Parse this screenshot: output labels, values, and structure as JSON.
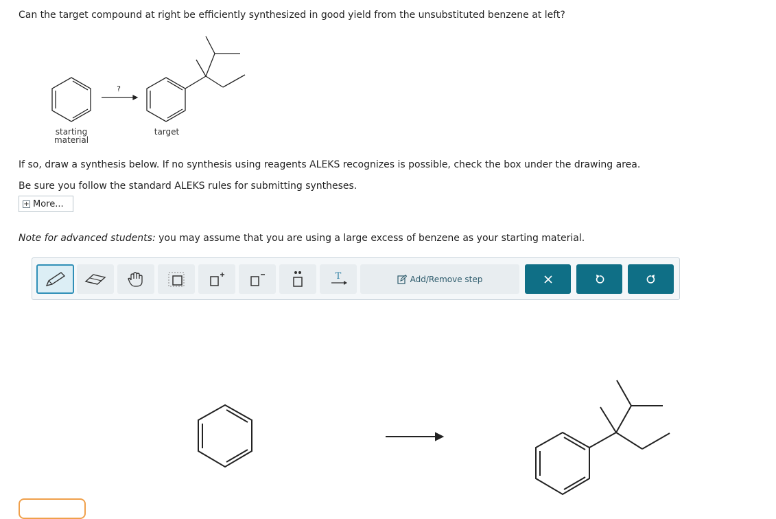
{
  "question": "Can the target compound at right be efficiently synthesized in good yield from the unsubstituted benzene at left?",
  "scheme": {
    "arrow_label": "?",
    "starting_label_line1": "starting",
    "starting_label_line2": "material",
    "target_label": "target"
  },
  "instructions": {
    "line1": "If so, draw a synthesis below. If no synthesis using reagents ALEKS recognizes is possible, check the box under the drawing area.",
    "line2": "Be sure you follow the standard ALEKS rules for submitting syntheses.",
    "more_label": "More..."
  },
  "note": {
    "prefix": "Note for advanced students:",
    "body": " you may assume that you are using a large excess of benzene as your starting material."
  },
  "toolbar": {
    "add_remove_step": "Add/Remove step",
    "tools": [
      "pencil-icon",
      "eraser-icon",
      "hand-icon",
      "select-box-icon",
      "add-charge-icon",
      "remove-charge-icon",
      "lone-pair-icon",
      "text-arrow-icon"
    ],
    "actions": [
      "clear-icon",
      "undo-icon",
      "redo-icon"
    ],
    "accent": "#0f6f86"
  }
}
